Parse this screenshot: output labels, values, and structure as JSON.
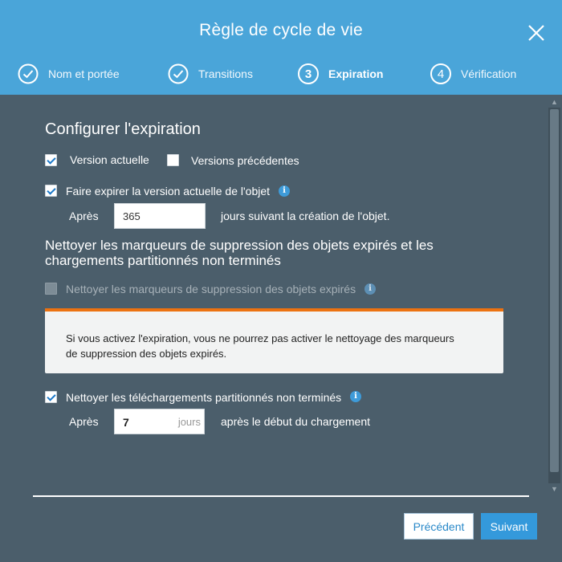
{
  "dialog": {
    "title": "Règle de cycle de vie"
  },
  "steps": [
    {
      "label": "Nom et portée",
      "state": "done"
    },
    {
      "label": "Transitions",
      "state": "done"
    },
    {
      "number": "3",
      "label": "Expiration",
      "state": "active"
    },
    {
      "number": "4",
      "label": "Vérification",
      "state": "pending"
    }
  ],
  "section1": {
    "heading": "Configurer l'expiration",
    "current_version_label": "Version actuelle",
    "current_version_checked": true,
    "previous_versions_label": "Versions précédentes",
    "previous_versions_checked": false,
    "expire_current_label": "Faire expirer la version actuelle de l'objet",
    "expire_current_checked": true,
    "after_label": "Après",
    "days_value": "365",
    "days_suffix": "jours suivant la création de l'objet."
  },
  "section2": {
    "heading": "Nettoyer les marqueurs de suppression des objets expirés et les chargements partitionnés non terminés",
    "cleanup_markers_label": "Nettoyer les marqueurs de suppression des objets expirés",
    "cleanup_markers_checked": false,
    "cleanup_markers_disabled": true,
    "warning_text": "Si vous activez l'expiration, vous ne pourrez pas activer le nettoyage des marqueurs de suppression des objets expirés.",
    "cleanup_uploads_label": "Nettoyer les téléchargements partitionnés non terminés",
    "cleanup_uploads_checked": true,
    "after_label": "Après",
    "uploads_days_value": "7",
    "uploads_days_unit": "jours",
    "uploads_suffix": "après le début du chargement"
  },
  "footer": {
    "previous_label": "Précédent",
    "next_label": "Suivant"
  },
  "colors": {
    "header": "#4aa5d9",
    "body": "#4b5e6b",
    "accent_warning": "#ec7211",
    "primary_button": "#3499db"
  }
}
